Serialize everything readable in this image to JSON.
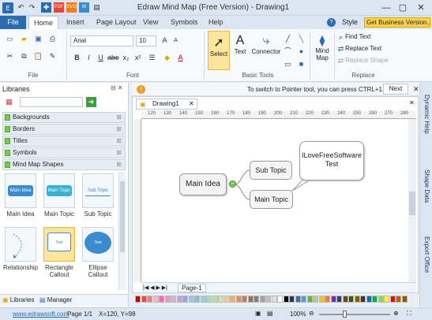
{
  "window": {
    "title": "Edraw Mind Map (Free Version) - Drawing1",
    "quick_access": [
      "new-icon",
      "open-icon",
      "save-icon",
      "undo-icon",
      "redo-icon",
      "pdf-icon",
      "svg-icon",
      "export-icon",
      "share-icon"
    ]
  },
  "menu_tabs": [
    {
      "label": "File",
      "active": false
    },
    {
      "label": "Home",
      "active": true
    },
    {
      "label": "Insert",
      "active": false
    },
    {
      "label": "Page Layout",
      "active": false
    },
    {
      "label": "View",
      "active": false
    },
    {
      "label": "Symbols",
      "active": false
    },
    {
      "label": "Help",
      "active": false
    }
  ],
  "top_right": {
    "style_label": "Style",
    "business_label": "Get Business Version..."
  },
  "ribbon": {
    "file_group_label": "File",
    "font_group_label": "Font",
    "basic_tools_label": "Basic Tools",
    "replace_group_label": "Replace",
    "font_name": "Arial",
    "font_size": "10",
    "select_label": "Select",
    "text_label": "Text",
    "connector_label": "Connector",
    "mind_map_label": "Mind\nMap",
    "find_text": "Find Text",
    "replace_text": "Replace Text",
    "replace_shape": "Replace Shape"
  },
  "info": {
    "message": "To switch to Pointer tool, you can press CTRL+1.",
    "next_label": "Next"
  },
  "libraries": {
    "title": "Libraries",
    "categories": [
      "Backgrounds",
      "Borders",
      "Titles",
      "Symbols",
      "Mind Map Shapes"
    ],
    "shapes": [
      {
        "label": "Main Idea",
        "tile_text": "Main Idea"
      },
      {
        "label": "Main Topic",
        "tile_text": "Main Topic"
      },
      {
        "label": "Sub Topic",
        "tile_text": "Sub Topic"
      },
      {
        "label": "Relationship",
        "tile_text": ""
      },
      {
        "label": "Rectangle\nCallout",
        "tile_text": "Text"
      },
      {
        "label": "Ellipse\nCallout",
        "tile_text": "Text"
      }
    ],
    "bottom_tabs": [
      "Libraries",
      "Manager"
    ]
  },
  "document": {
    "tab_label": "Drawing1",
    "page_label": "Page-1",
    "ruler_marks": [
      "120",
      "130",
      "140",
      "150",
      "160",
      "170",
      "180",
      "190",
      "200",
      "210",
      "220",
      "230",
      "240",
      "250",
      "260",
      "270",
      "280"
    ],
    "nodes": {
      "main_idea": "Main Idea",
      "sub_topic": "Sub Topic",
      "main_topic": "Main Topic",
      "callout": "ILoveFreeSoftware Test"
    }
  },
  "right_tabs": [
    "Dynamic Help",
    "Shape Data",
    "Export Office"
  ],
  "palette": [
    "#c00000",
    "#e74c3c",
    "#f08080",
    "#ffb6c1",
    "#ff69b4",
    "#e0a0c0",
    "#d8b0e0",
    "#c0a0e0",
    "#a0a0e0",
    "#a0c0f0",
    "#80c0e0",
    "#80e0e0",
    "#a0e0c0",
    "#c0e0a0",
    "#e0e0a0",
    "#f0d080",
    "#f0b070",
    "#e09060",
    "#c08060",
    "#a07050",
    "#808080",
    "#a0a0a0",
    "#c0c0c0",
    "#e0e0e0",
    "#ffffff",
    "#000000",
    "#1f3864",
    "#2e75b6",
    "#5b9bd5",
    "#70ad47",
    "#a9d08e",
    "#ffc000",
    "#ed7d31",
    "#7030a0",
    "#264478",
    "#843c0c",
    "#375623",
    "#7f6000",
    "#3b3838",
    "#0070c0",
    "#00b050",
    "#92d050",
    "#ffff00",
    "#ff0000",
    "#c55a11",
    "#806000"
  ],
  "status": {
    "website": "www.edrawsoft.com",
    "page": "Page 1/1",
    "coords": "X=120, Y=98",
    "zoom": "100%"
  }
}
